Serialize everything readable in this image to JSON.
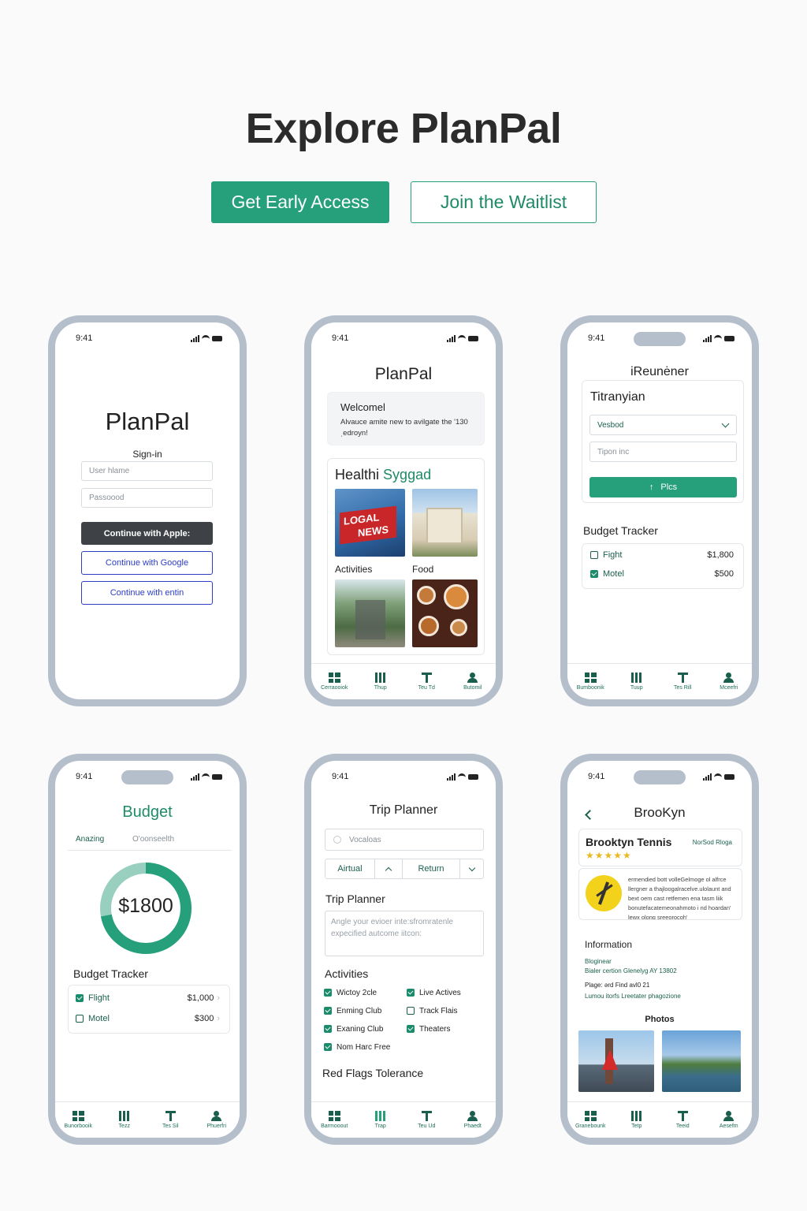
{
  "hero": {
    "title": "Explore PlanPal",
    "primary_cta": "Get Early Access",
    "secondary_cta": "Join the Waitlist"
  },
  "colors": {
    "accent": "#26a07a",
    "dark_green": "#1a5f4d",
    "frame": "#b4bfcb"
  },
  "status_time": "9:41",
  "tabs_phone2": [
    "Cerraooiok",
    "Thup",
    "Teu Td",
    "Butomil"
  ],
  "tabs_phone3": [
    "Bumboonik",
    "Tuup",
    "Tes Rill",
    "Mceefri"
  ],
  "tabs_phone4": [
    "Bunorbooik",
    "Tezz",
    "Tes Sil",
    "Phuerfri"
  ],
  "tabs_phone5": [
    "Barmooout",
    "Trap",
    "Teu Ud",
    "Phaedt"
  ],
  "tabs_phone6": [
    "Granebounk",
    "Tetp",
    "Teeid",
    "Aesefm"
  ],
  "phone1": {
    "app_name": "PlanPal",
    "heading": "Sign-in",
    "username_placeholder": "User hlame",
    "password_placeholder": "Passoood",
    "apple": "Continue with Apple:",
    "google": "Continue with Google",
    "other": "Continue with entin"
  },
  "phone2": {
    "app_name": "PlanPal",
    "welcome_title": "Welcomel",
    "welcome_text": "Alvauce amite new to avilgate the '130 ˌedroyn!",
    "section_title_a": "Healthi",
    "section_title_b": "Syggad",
    "news_line1": "LOGAL",
    "news_line2": "NEWS",
    "label_activities": "Activities",
    "label_food": "Food"
  },
  "phone3": {
    "title": "iReunėner",
    "card_title": "Titranyian",
    "select_value": "Vesbod",
    "input_placeholder": "Tipon inc",
    "button": "Plcs",
    "budget_title": "Budget Tracker",
    "items": [
      {
        "label": "Fight",
        "amount": "$1,800"
      },
      {
        "label": "Motel",
        "amount": "$500"
      }
    ]
  },
  "phone4": {
    "title": "Budget",
    "tab_a": "Anazing",
    "tab_b": "O'oonseelth",
    "total": "$1800",
    "ring_fill": 0.72,
    "budget_title": "Budget Tracker",
    "items": [
      {
        "label": "Flight",
        "amount": "$1,000"
      },
      {
        "label": "Motel",
        "amount": "$300"
      }
    ]
  },
  "phone5": {
    "title": "Trip Planner",
    "search_placeholder": "Vocaloas",
    "seg_a": "Airtual",
    "seg_b": "Return",
    "section": "Trip Planner",
    "textarea": "Angle your evioer inte:sfromratenle expecified autcome iitcon:",
    "activities_title": "Activities",
    "activities": [
      {
        "left": "Wictoy 2cle",
        "right": "Live Actives"
      },
      {
        "left": "Enming Club",
        "right": "Track Flais"
      },
      {
        "left": "Exaning Club",
        "right": "Theaters"
      },
      {
        "left": "Nom Harc Free",
        "right": ""
      }
    ],
    "footer": "Red Flags Tolerance"
  },
  "phone6": {
    "title": "BrooKyn",
    "venue": "Brooktyn Tennis",
    "venue_tag": "NorSod Rloga",
    "stars": "★★★★★",
    "desc": "ermendied bott volleGelmoge ol alfrce llergner a thajloogalracelve.ulolaunt and bext oem cast retfemen ena tasm liik bonutefacatemeonahmoto i nd hoardan' lewx olong sreeorocoh'",
    "info_title": "Information",
    "info_line1": "Bloginear",
    "info_line2": "Bialer certion Glenelyg AY 13802",
    "info_line3": "Plage: ərd Find avl0 21",
    "info_line4": "Lumou itorfs Lreetater phagozione",
    "photos_title": "Photos"
  }
}
